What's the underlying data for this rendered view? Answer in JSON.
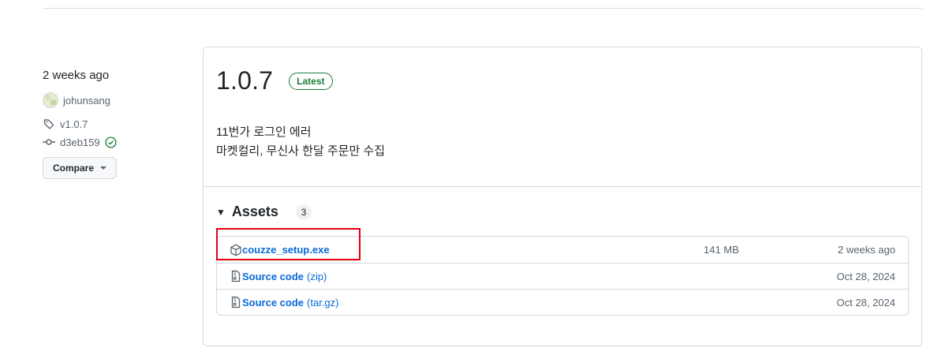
{
  "sidebar": {
    "date": "2 weeks ago",
    "author": "johunsang",
    "tag": "v1.0.7",
    "commit": "d3eb159",
    "compare_label": "Compare"
  },
  "release": {
    "title": "1.0.7",
    "badge": "Latest",
    "body_lines": [
      "11번가 로그인 에러",
      "마켓컬리, 무신사 한달 주문만 수집"
    ]
  },
  "assets": {
    "title": "Assets",
    "count": "3",
    "items": [
      {
        "name": "couzze_setup.exe",
        "suffix": "",
        "size": "141 MB",
        "date": "2 weeks ago",
        "icon": "package-icon"
      },
      {
        "name": "Source code",
        "suffix": "(zip)",
        "size": "",
        "date": "Oct 28, 2024",
        "icon": "file-zip-icon"
      },
      {
        "name": "Source code",
        "suffix": "(tar.gz)",
        "size": "",
        "date": "Oct 28, 2024",
        "icon": "file-zip-icon"
      }
    ]
  },
  "colors": {
    "link": "#0969da",
    "latest": "#1a7f37",
    "highlight": "#e8000b"
  }
}
